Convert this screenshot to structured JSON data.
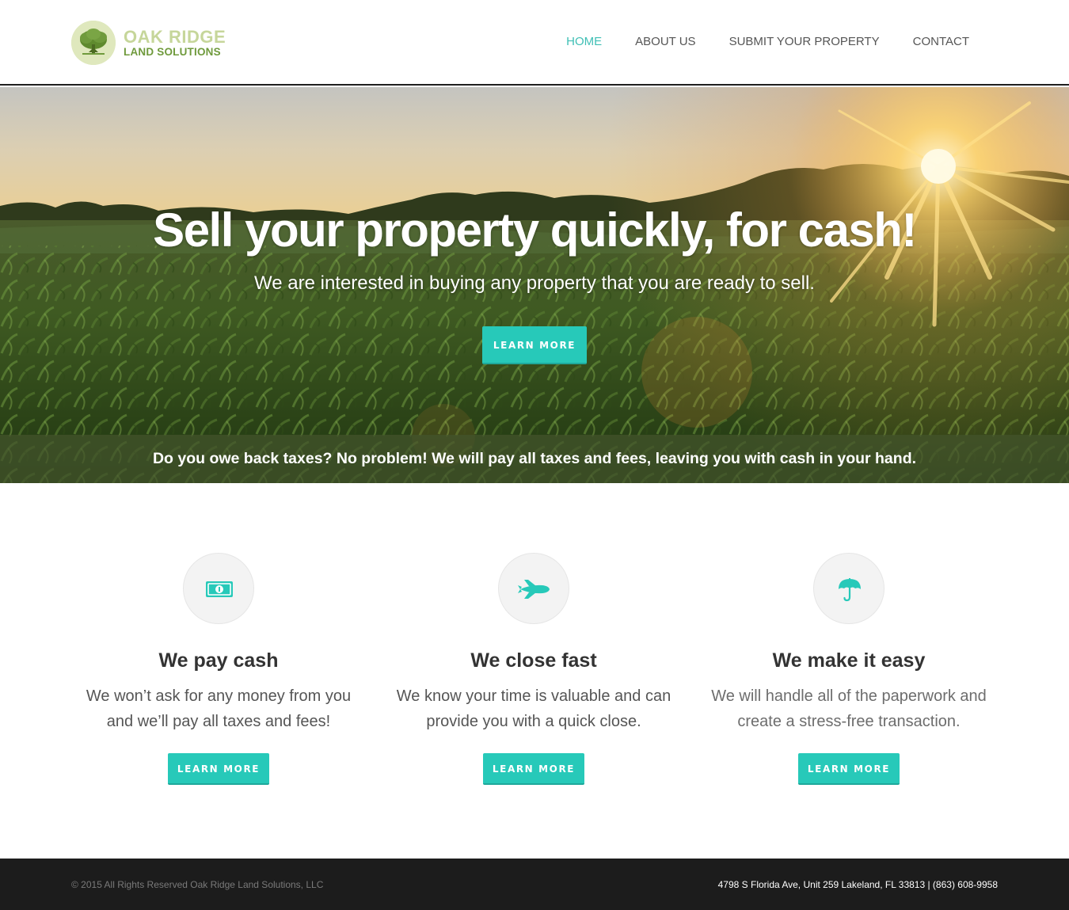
{
  "brand": {
    "name_line1": "OAK RIDGE",
    "name_line2": "LAND SOLUTIONS",
    "colors": {
      "accent": "#27c9b9",
      "nav_active": "#3fbfb5",
      "logo_light": "#c6d69a",
      "logo_dark": "#6f9a3c"
    }
  },
  "nav": {
    "items": [
      {
        "label": "HOME",
        "active": true
      },
      {
        "label": "ABOUT US",
        "active": false
      },
      {
        "label": "SUBMIT YOUR PROPERTY",
        "active": false
      },
      {
        "label": "CONTACT",
        "active": false
      }
    ]
  },
  "hero": {
    "title": "Sell your property quickly, for cash!",
    "subtitle": "We are interested in buying any property that you are ready to sell.",
    "button_label": "LEARN MORE",
    "band_text": "Do you owe back taxes? No problem! We will pay all taxes and fees, leaving you with cash in your hand."
  },
  "features": [
    {
      "icon": "money-bill-icon",
      "title": "We pay cash",
      "description": "We won’t ask for any money from you and we’ll pay all taxes and fees!",
      "button_label": "LEARN MORE"
    },
    {
      "icon": "jet-icon",
      "title": "We close fast",
      "description": "We know your time is valuable and can provide you with a quick close.",
      "button_label": "LEARN MORE"
    },
    {
      "icon": "umbrella-icon",
      "title": "We make it easy",
      "description": "We will handle all of the paperwork and create a stress-free transaction.",
      "button_label": "LEARN MORE"
    }
  ],
  "footer": {
    "copyright": "© 2015 All Rights Reserved Oak Ridge Land Solutions, LLC",
    "address": "4798 S Florida Ave, Unit 259 Lakeland, FL 33813 | (863) 608-9958"
  }
}
